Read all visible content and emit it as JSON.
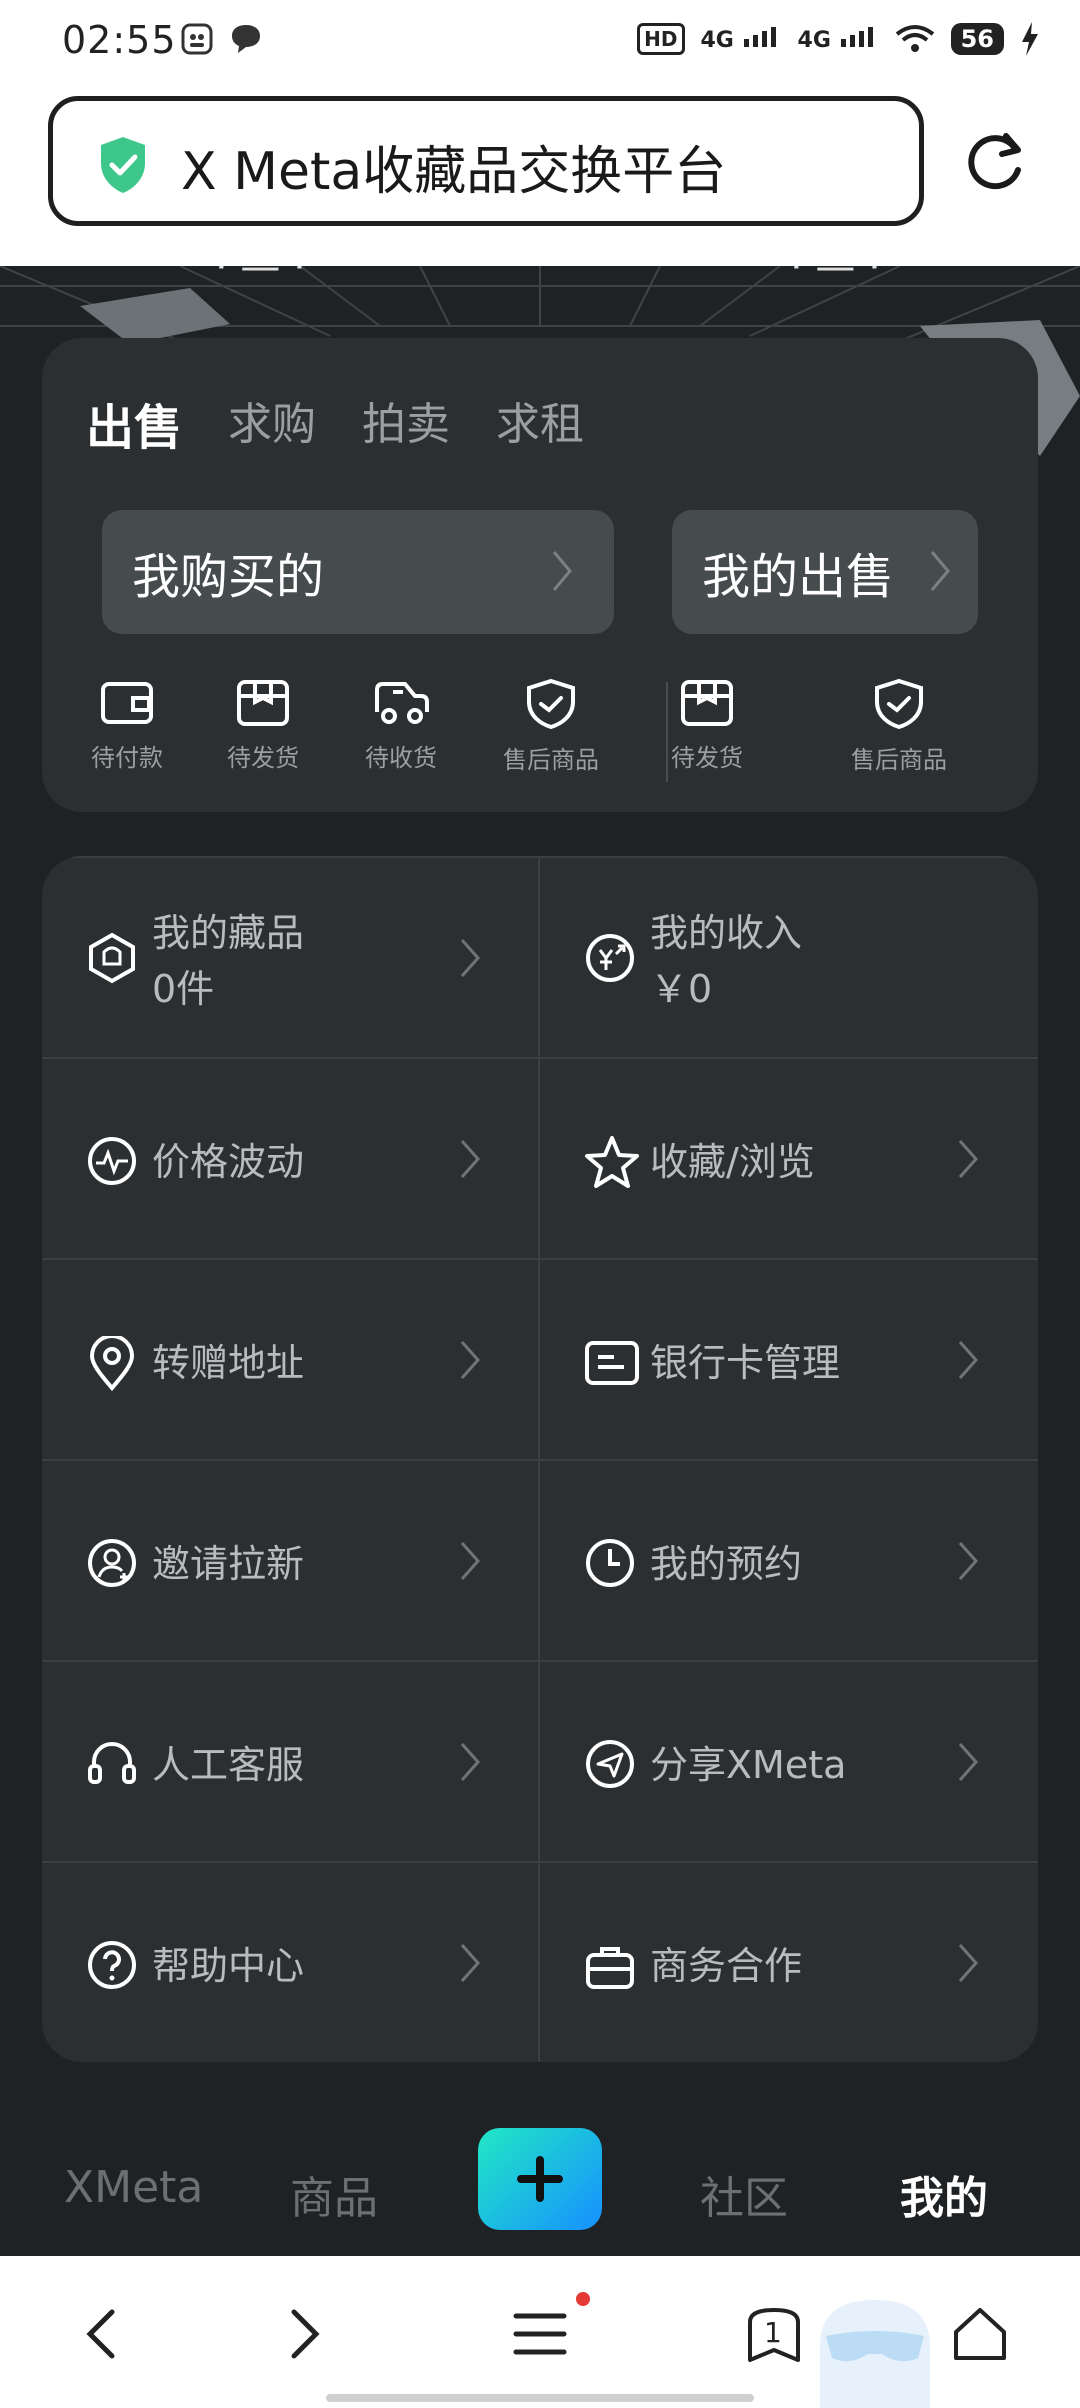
{
  "status": {
    "time": "02:55",
    "hd": "HD",
    "net1": "4G",
    "net2": "4G",
    "battery": "56"
  },
  "browser": {
    "title": "X Meta收藏品交换平台",
    "tab_count": "1"
  },
  "trade": {
    "tabs": [
      {
        "label": "出售",
        "active": true
      },
      {
        "label": "求购",
        "active": false
      },
      {
        "label": "拍卖",
        "active": false
      },
      {
        "label": "求租",
        "active": false
      }
    ],
    "buy_button": "我购买的",
    "sell_button": "我的出售",
    "buy_orders": [
      {
        "label": "待付款",
        "icon": "wallet-icon"
      },
      {
        "label": "待发货",
        "icon": "package-icon"
      },
      {
        "label": "待收货",
        "icon": "truck-icon"
      },
      {
        "label": "售后商品",
        "icon": "shield-check-icon"
      }
    ],
    "sell_orders": [
      {
        "label": "待发货",
        "icon": "package-icon"
      },
      {
        "label": "售后商品",
        "icon": "shield-check-icon"
      }
    ]
  },
  "menu": {
    "collection": {
      "label": "我的藏品",
      "value": "0件"
    },
    "income": {
      "label": "我的收入",
      "value": "￥0"
    },
    "items": [
      {
        "label": "价格波动",
        "icon": "pulse-icon"
      },
      {
        "label": "收藏/浏览",
        "icon": "star-icon"
      },
      {
        "label": "转赠地址",
        "icon": "location-icon"
      },
      {
        "label": "银行卡管理",
        "icon": "card-icon"
      },
      {
        "label": "邀请拉新",
        "icon": "user-add-icon"
      },
      {
        "label": "我的预约",
        "icon": "clock-icon"
      },
      {
        "label": "人工客服",
        "icon": "headset-icon"
      },
      {
        "label": "分享XMeta",
        "icon": "share-icon"
      },
      {
        "label": "帮助中心",
        "icon": "help-icon"
      },
      {
        "label": "商务合作",
        "icon": "briefcase-icon"
      }
    ]
  },
  "app_nav": {
    "items": [
      {
        "label": "XMeta",
        "active": false
      },
      {
        "label": "商品",
        "active": false
      },
      {
        "label": "社区",
        "active": false
      },
      {
        "label": "我的",
        "active": true
      }
    ]
  },
  "colors": {
    "accent_start": "#22e8c4",
    "accent_end": "#1690ff",
    "secure_green": "#3ec78a",
    "card_bg": "#2c2f31",
    "page_bg": "#1f2224"
  }
}
